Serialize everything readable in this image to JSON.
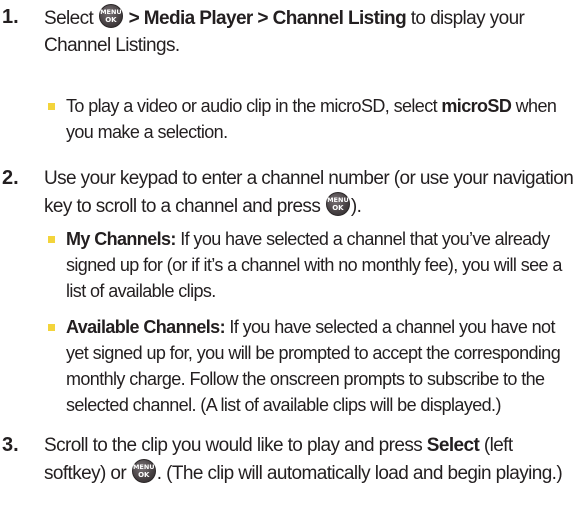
{
  "bullet_color": "#f3d43b",
  "text_color": "#231f20",
  "icon": "menu-ok-key-icon",
  "key_label": {
    "top": "MENU",
    "bottom": "OK"
  },
  "steps": [
    {
      "number": "1.",
      "pre": "Select ",
      "path": " > Media Player > Channel Listing",
      "post": " to display your Channel Listings.",
      "bullets": [
        {
          "pre": "To play a video or audio clip in the microSD, select ",
          "bold": "microSD",
          "post": " when you make a selection."
        }
      ]
    },
    {
      "number": "2.",
      "pre": "Use your keypad to enter a channel number (or use your navigation key to scroll to a channel and press ",
      "post": ").",
      "bullets": [
        {
          "bold": "My Channels:",
          "text": " If you have selected a channel that you’ve already signed up for (or if it’s a channel with no monthly fee), you will see a list of available clips."
        },
        {
          "bold": "Available Channels:",
          "text": " If you have selected a channel you have not yet signed up for, you will be prompted to accept the corresponding monthly charge. Follow the onscreen prompts to subscribe to the selected channel. (A list of available clips will be displayed.)"
        }
      ]
    },
    {
      "number": "3.",
      "pre": "Scroll to the clip you would like to play and press ",
      "bold": "Select",
      "mid": " (left softkey) or ",
      "post": ". (The clip will automatically load and begin playing.)"
    }
  ]
}
